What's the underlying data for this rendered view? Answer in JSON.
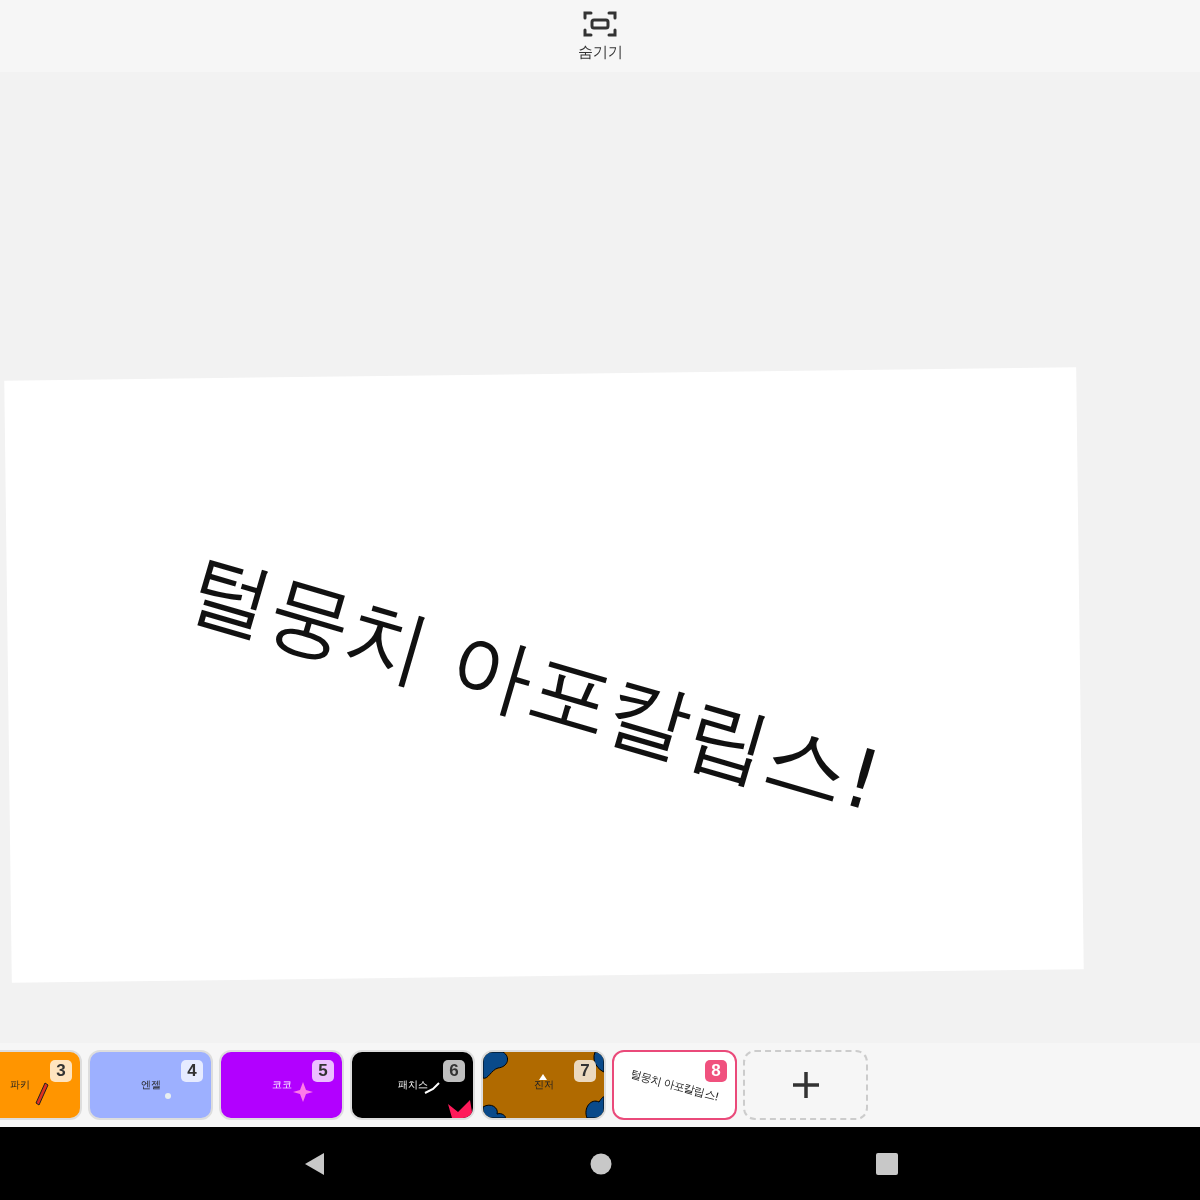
{
  "top_bar": {
    "hide_button": {
      "label": "숨기기"
    }
  },
  "slide": {
    "title": "털뭉치 아포칼립스!"
  },
  "slides": [
    {
      "number": "3",
      "title": "파키",
      "color": "#ff9500",
      "kind": "pencil",
      "selected": false
    },
    {
      "number": "4",
      "title": "엔젤",
      "color": "#9db0ff",
      "kind": "dot",
      "selected": false
    },
    {
      "number": "5",
      "title": "코코",
      "color": "#b200ff",
      "kind": "sparkle",
      "selected": false
    },
    {
      "number": "6",
      "title": "패치스",
      "color": "#000000",
      "kind": "tick",
      "selected": false
    },
    {
      "number": "7",
      "title": "진저",
      "color": "#b06a00",
      "kind": "blobs",
      "selected": false
    },
    {
      "number": "8",
      "title": "털뭉치 아포칼립스!",
      "color": "#ffffff",
      "kind": "none",
      "selected": true
    }
  ]
}
